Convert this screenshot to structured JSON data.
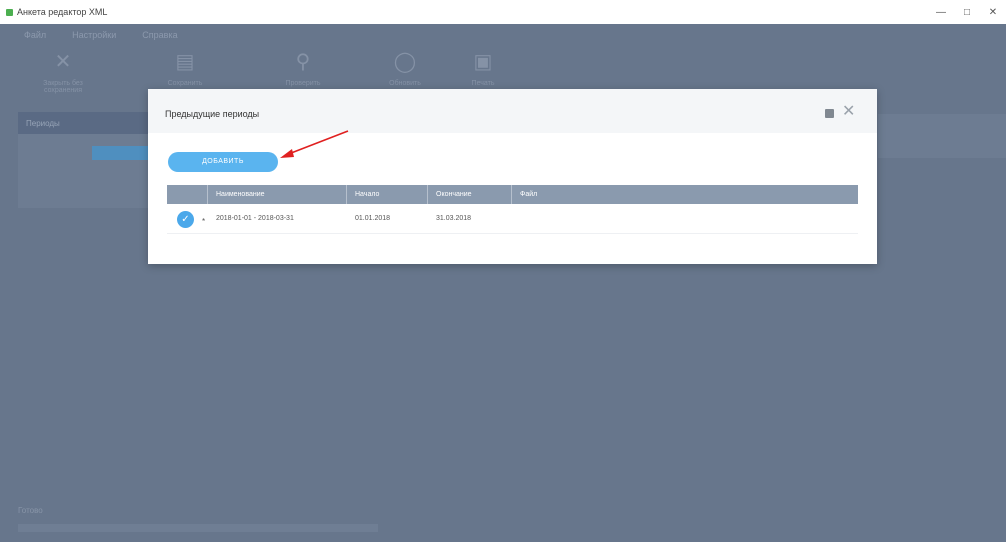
{
  "window": {
    "title": "Анкета редактор XML",
    "controls": [
      "—",
      "□",
      "✕"
    ]
  },
  "menu": [
    "Файл",
    "Настройки",
    "Справка"
  ],
  "toolbar": [
    {
      "icon": "✕",
      "label": "Закрыть без сохранения"
    },
    {
      "icon": "▤",
      "label": "Сохранить"
    },
    {
      "icon": "⚲",
      "label": "Проверить"
    },
    {
      "icon": "◯",
      "label": "Обновить"
    },
    {
      "icon": "▣",
      "label": "Печать"
    }
  ],
  "left_panel": {
    "header": "Периоды"
  },
  "status": {
    "text": "Готово"
  },
  "dialog": {
    "title": "Предыдущие периоды",
    "add_button": "ДОБАВИТЬ",
    "columns": [
      "",
      "Наименование",
      "Начало",
      "Окончание",
      "Файл"
    ],
    "rows": [
      {
        "name": "2018-01-01 - 2018-03-31",
        "start": "01.01.2018",
        "end": "31.03.2018",
        "file": "",
        "selected": true
      }
    ]
  },
  "colors": {
    "overlay": "#67768c",
    "accent": "#5ab4ef",
    "grid_header": "#8a9aae",
    "annotation_arrow": "#e02020"
  }
}
